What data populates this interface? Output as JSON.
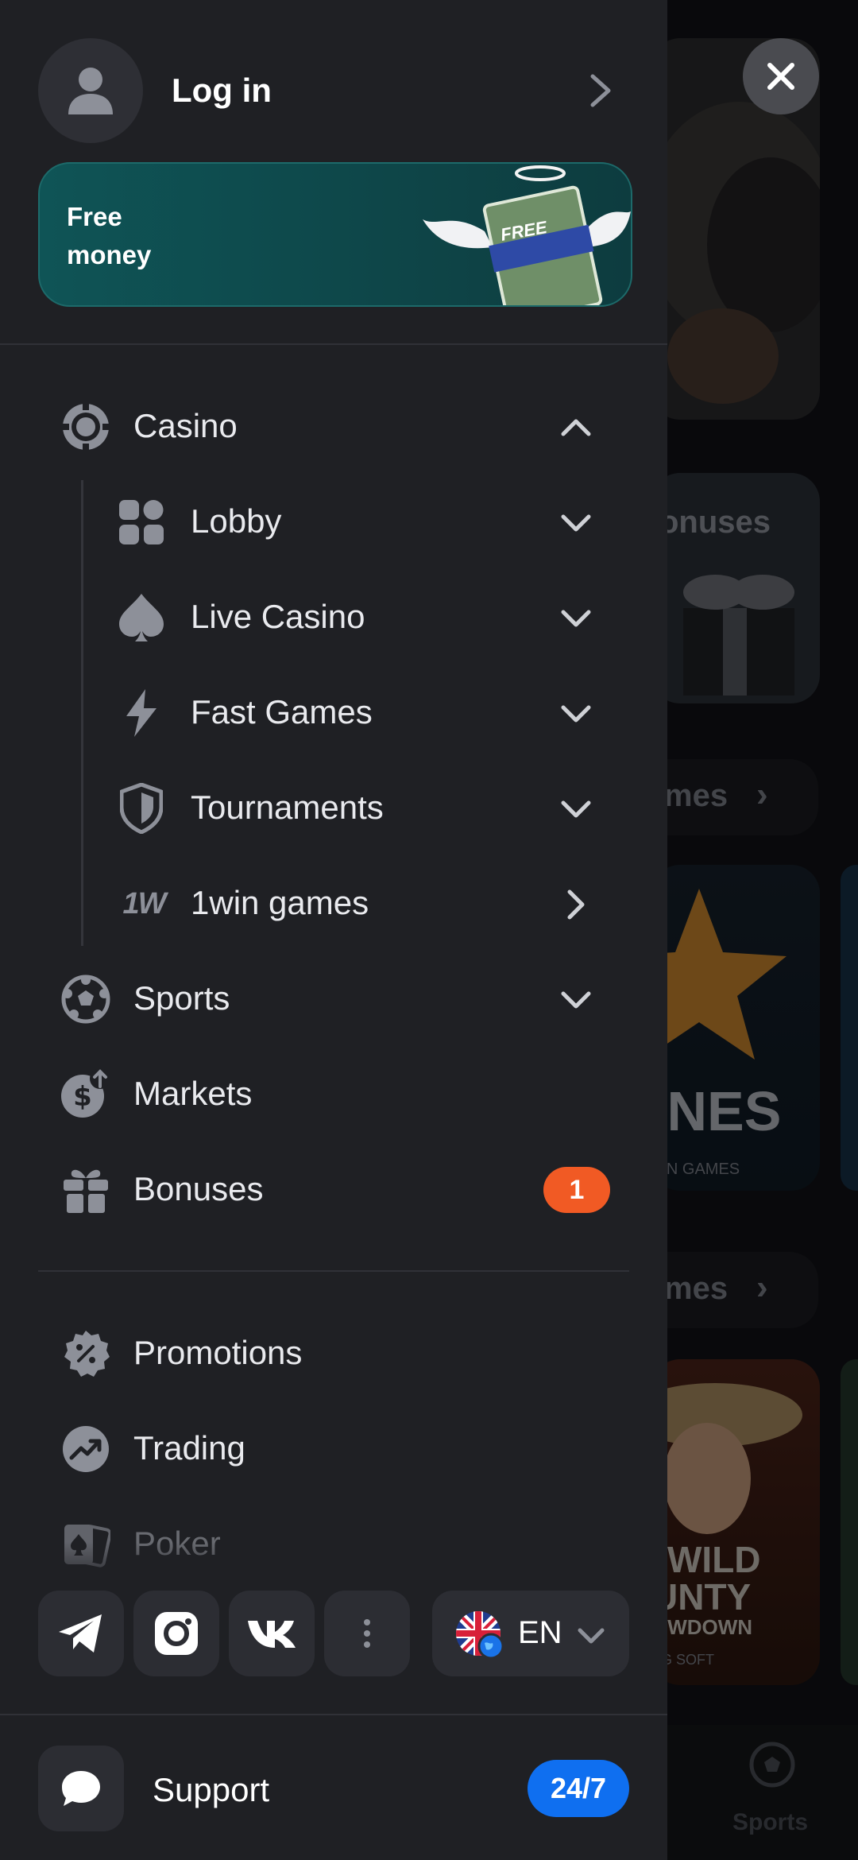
{
  "drawer": {
    "login_label": "Log in",
    "promo_text_line1": "Free",
    "promo_text_line2": "money",
    "promo_bill_label": "FREE",
    "casino_label": "Casino",
    "submenu": [
      {
        "label": "Lobby"
      },
      {
        "label": "Live Casino"
      },
      {
        "label": "Fast Games"
      },
      {
        "label": "Tournaments"
      },
      {
        "label": "1win games"
      }
    ],
    "sports_label": "Sports",
    "markets_label": "Markets",
    "bonuses_label": "Bonuses",
    "bonuses_badge": "1",
    "promotions_label": "Promotions",
    "trading_label": "Trading",
    "poker_label": "Poker",
    "language_code": "EN",
    "support_label": "Support",
    "support_badge": "24/7",
    "onewin_logo": "1W"
  },
  "background": {
    "card_bonuses": "onuses",
    "section_games_1": "mes",
    "section_games_2": "mes",
    "game_title": "INES",
    "game_subtitle": "VIN GAMES",
    "game2_title_line1": "WILD",
    "game2_title_line2": "UNTY",
    "game2_title_line3": "OWDOWN",
    "game2_provider": "PG SOFT",
    "bottom_nav_sports": "Sports"
  },
  "colors": {
    "drawer_bg": "#1f2024",
    "badge_orange": "#f15a24",
    "badge_blue": "#0f6ff0",
    "promo_bg": "#0e4a4c"
  }
}
